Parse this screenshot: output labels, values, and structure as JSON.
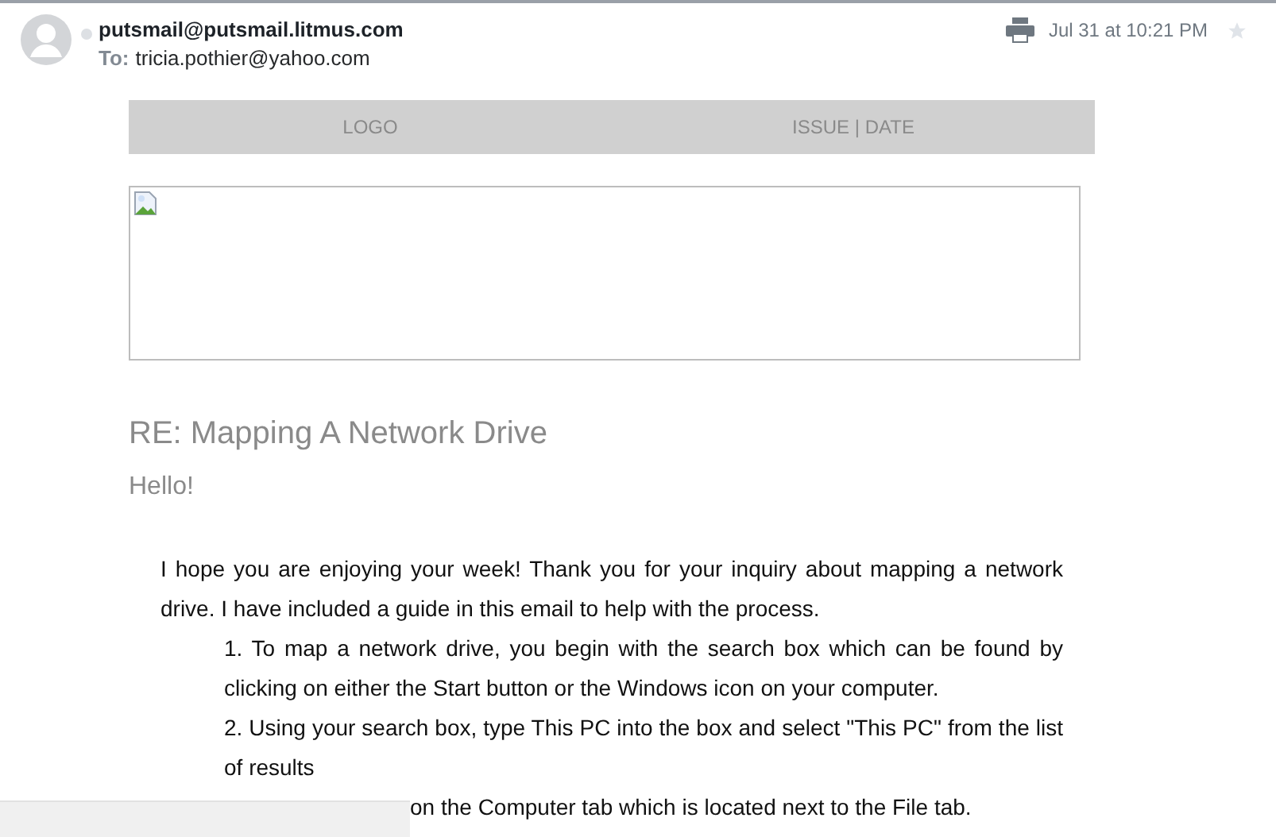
{
  "header": {
    "sender": "putsmail@putsmail.litmus.com",
    "to_label": "To:",
    "recipient": "tricia.pothier@yahoo.com",
    "date": "Jul 31 at 10:21 PM",
    "starred": false
  },
  "banner": {
    "left": "LOGO",
    "right": "ISSUE | DATE"
  },
  "title": "RE: Mapping A Network Drive",
  "greeting": "Hello!",
  "intro": "I hope you are enjoying your week! Thank you for your inquiry about mapping a network drive. I have included a guide in this email to help with the process.",
  "steps": [
    {
      "kind": "full",
      "text": "1. To map a network drive, you begin with the search box which can be found by clicking on either the Start button or the Windows icon on your computer."
    },
    {
      "kind": "full",
      "text": "2. Using your search box, type This PC into the box and select \"This PC\" from the list of results"
    },
    {
      "kind": "partial",
      "text": "on the Computer tab which is located next to the File tab."
    }
  ]
}
